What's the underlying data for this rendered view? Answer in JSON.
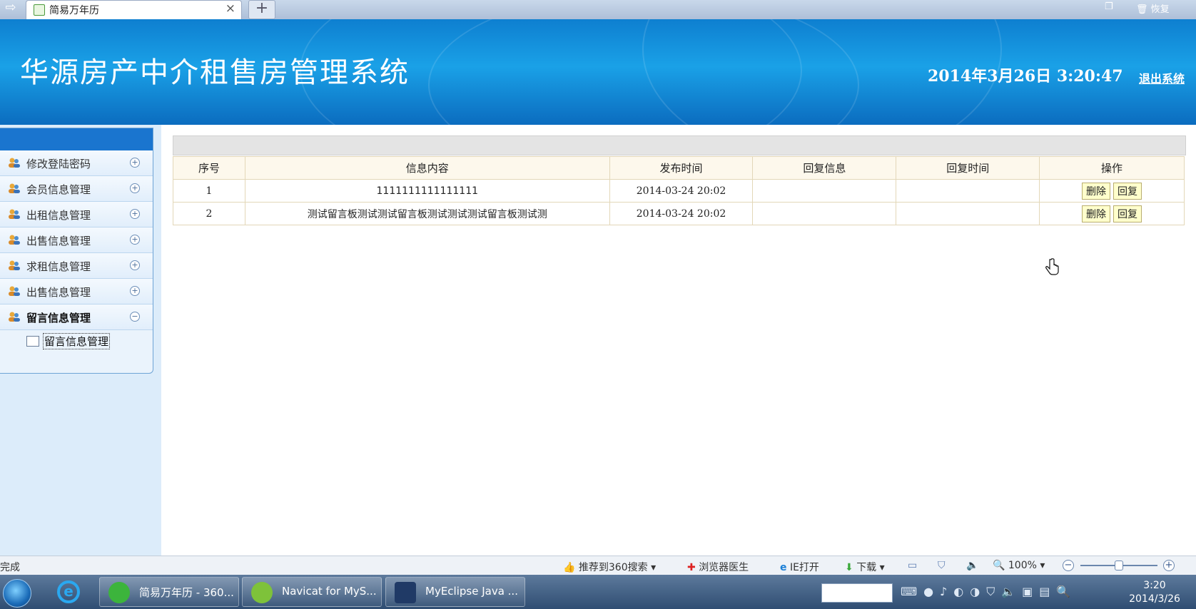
{
  "browser": {
    "tab_title": "简易万年历",
    "tab_close": "×",
    "new_tab": "+",
    "restore_label": "恢复"
  },
  "header": {
    "title": "华源房产中介租售房管理系统",
    "datetime": "2014年3月26日  3:20:47",
    "logout": "退出系统"
  },
  "sidebar": {
    "items": [
      {
        "label": "修改登陆密码",
        "toggle": "+"
      },
      {
        "label": "会员信息管理",
        "toggle": "+"
      },
      {
        "label": "出租信息管理",
        "toggle": "+"
      },
      {
        "label": "出售信息管理",
        "toggle": "+"
      },
      {
        "label": "求租信息管理",
        "toggle": "+"
      },
      {
        "label": "出售信息管理",
        "toggle": "+"
      },
      {
        "label": "留言信息管理",
        "toggle": "−"
      }
    ],
    "subitem": "留言信息管理"
  },
  "table": {
    "headers": [
      "序号",
      "信息内容",
      "发布时间",
      "回复信息",
      "回复时间",
      "操作"
    ],
    "rows": [
      {
        "no": "1",
        "content": "1111111111111111",
        "time": "2014-03-24 20:02",
        "reply": "",
        "reply_time": ""
      },
      {
        "no": "2",
        "content": "测试留言板测试测试留言板测试测试测试留言板测试测",
        "time": "2014-03-24 20:02",
        "reply": "",
        "reply_time": ""
      }
    ],
    "delete_label": "删除",
    "reply_label": "回复"
  },
  "statusbar": {
    "status": "完成",
    "recommend": "推荐到360搜索",
    "doctor": "浏览器医生",
    "ie_open": "IE打开",
    "download": "下载",
    "zoom": "100%"
  },
  "taskbar": {
    "windows": [
      "简易万年历 - 360...",
      "Navicat for MyS...",
      "MyEclipse Java ..."
    ],
    "time": "3:20",
    "date": "2014/3/26"
  }
}
